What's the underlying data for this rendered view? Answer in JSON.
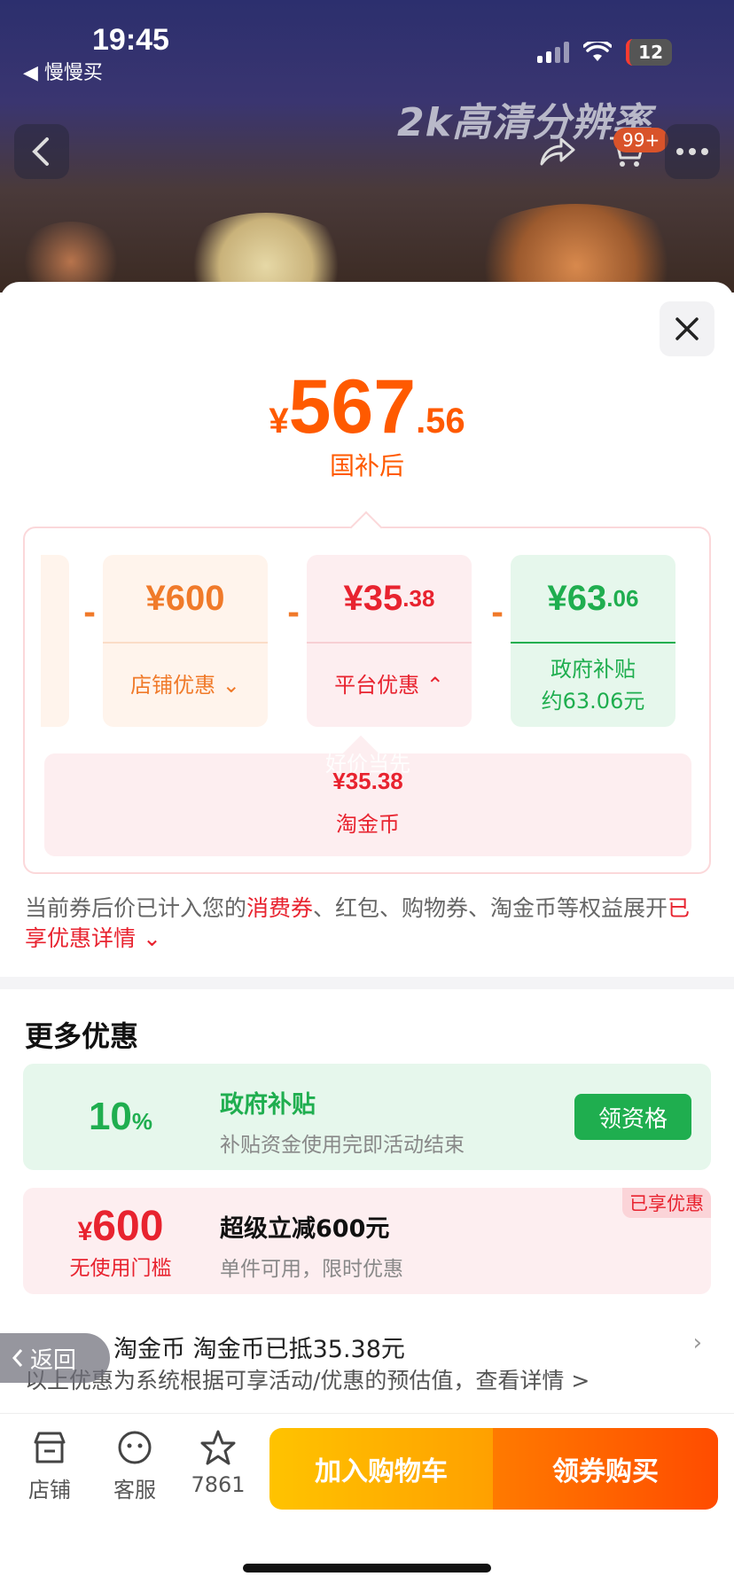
{
  "status": {
    "time": "19:45",
    "back_app": "◀ 慢慢买",
    "battery": "12"
  },
  "header": {
    "banner_text": "2k高清分辨率",
    "cart_badge": "99+"
  },
  "price": {
    "currency": "¥",
    "integer": "567",
    "decimal": ".56",
    "label": "国补后"
  },
  "breakdown": {
    "cards": [
      {
        "currency": "¥",
        "integer": "600",
        "decimal": "",
        "label": "店铺优惠",
        "chevron": "⌄",
        "color": "#f07a2a"
      },
      {
        "currency": "¥",
        "integer": "35",
        "decimal": ".38",
        "label": "平台优惠",
        "chevron": "⌃",
        "color": "#e8232f"
      },
      {
        "currency": "¥",
        "integer": "63",
        "decimal": ".06",
        "label_line1": "政府补贴",
        "label_line2": "约63.06元",
        "color": "#1fae4f"
      }
    ],
    "operator": "-",
    "coin": {
      "watermark": "好价当先",
      "amount": "¥35.38",
      "label": "淘金币"
    }
  },
  "notice": {
    "part1": "当前券后价已计入您的",
    "highlight1": "消费券",
    "part2": "、红包、购物券、淘金币等权益展开",
    "highlight2": "已享优惠详情 ⌄"
  },
  "more_offers": {
    "title": "更多优惠",
    "items": [
      {
        "left_value": "10",
        "left_unit": "%",
        "title": "政府补贴",
        "subtitle": "补贴资金使用完即活动结束",
        "button": "领资格"
      },
      {
        "left_currency": "¥",
        "left_value": "600",
        "left_sub": "无使用门槛",
        "title": "超级立减600元",
        "subtitle": "单件可用，限时优惠",
        "tag": "已享优惠"
      }
    ],
    "coin_row": "淘金币 淘金币已抵35.38元",
    "coin_row_arrow": "›",
    "estimate": "以上优惠为系统根据可享活动/优惠的预估值，查看详情 >",
    "back_pill": "返回"
  },
  "bottom_bar": {
    "store": "店铺",
    "service": "客服",
    "favorites": "7861",
    "add_to_cart": "加入购物车",
    "buy": "领券购买"
  },
  "colors": {
    "accent_orange": "#ff5a00",
    "accent_red": "#e8232f",
    "accent_green": "#1fae4f"
  }
}
